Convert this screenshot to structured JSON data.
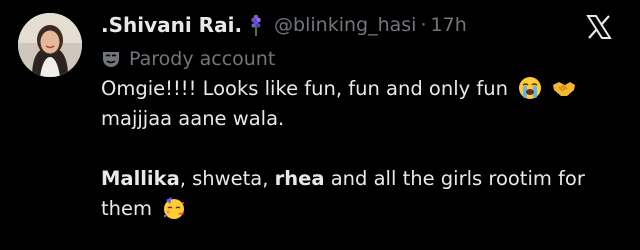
{
  "author": {
    "display_name": ".Shivani Rai.",
    "name_emoji": "hyacinth-icon",
    "handle": "@blinking_hasi",
    "separator": "·",
    "time": "17h",
    "label": "Parody account",
    "label_icon": "mask-icon"
  },
  "tweet": {
    "line1": "Omgie!!!! Looks like fun, fun and only fun",
    "line1_emojis": [
      "loudly-crying-face-icon",
      "handshake-icon"
    ],
    "line2": "majjjaa aane wala.",
    "line3_bold1": "Mallika",
    "line3_text1": ", shweta, ",
    "line3_bold2": "rhea",
    "line3_text2": " and all the girls rootim for",
    "line4": "them",
    "line4_emoji": "partying-face-icon"
  },
  "colors": {
    "background": "#000000",
    "text": "#e7e9ea",
    "muted": "#71767b"
  }
}
